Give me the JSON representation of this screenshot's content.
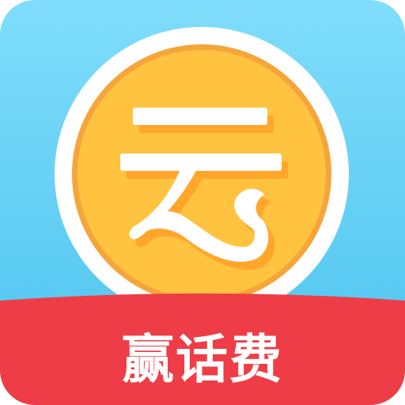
{
  "app_icon": {
    "logo_glyph": "云",
    "banner_label": "赢话费"
  },
  "colors": {
    "sky_top": "#7fdcfb",
    "sky_bottom": "#4cc4ef",
    "ring_white": "#ffffff",
    "coin_face": "#ffc23f",
    "coin_edge": "#f5a33a",
    "glyph_shadow": "#ffa62b",
    "banner_red": "#ee3d47",
    "banner_text": "#ffffff"
  },
  "icons": {
    "logo": "cloud-character-coin-icon"
  }
}
